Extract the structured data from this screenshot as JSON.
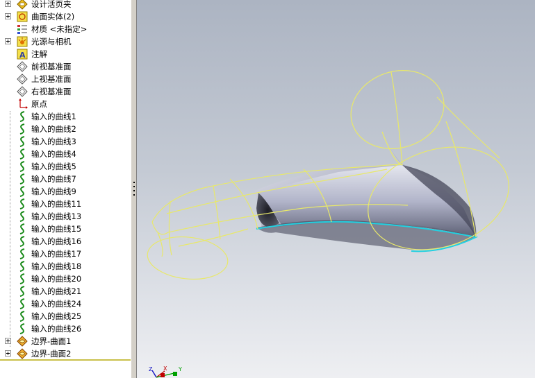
{
  "feature_tree": {
    "items": [
      {
        "label": "设计活页夹",
        "icon": "design-binder-icon",
        "expandable": true
      },
      {
        "label": "曲面实体(2)",
        "icon": "surface-bodies-icon",
        "expandable": true
      },
      {
        "label": "材质 <未指定>",
        "icon": "material-icon",
        "expandable": false
      },
      {
        "label": "光源与相机",
        "icon": "lights-cameras-icon",
        "expandable": true
      },
      {
        "label": "注解",
        "icon": "annotations-icon",
        "expandable": false
      },
      {
        "label": "前视基准面",
        "icon": "plane-icon",
        "expandable": false
      },
      {
        "label": "上视基准面",
        "icon": "plane-icon",
        "expandable": false
      },
      {
        "label": "右视基准面",
        "icon": "plane-icon",
        "expandable": false
      },
      {
        "label": "原点",
        "icon": "origin-icon",
        "expandable": false
      },
      {
        "label": "输入的曲线1",
        "icon": "curve-icon",
        "expandable": false
      },
      {
        "label": "输入的曲线2",
        "icon": "curve-icon",
        "expandable": false
      },
      {
        "label": "输入的曲线3",
        "icon": "curve-icon",
        "expandable": false
      },
      {
        "label": "输入的曲线4",
        "icon": "curve-icon",
        "expandable": false
      },
      {
        "label": "输入的曲线5",
        "icon": "curve-icon",
        "expandable": false
      },
      {
        "label": "输入的曲线7",
        "icon": "curve-icon",
        "expandable": false
      },
      {
        "label": "输入的曲线9",
        "icon": "curve-icon",
        "expandable": false
      },
      {
        "label": "输入的曲线11",
        "icon": "curve-icon",
        "expandable": false
      },
      {
        "label": "输入的曲线13",
        "icon": "curve-icon",
        "expandable": false
      },
      {
        "label": "输入的曲线15",
        "icon": "curve-icon",
        "expandable": false
      },
      {
        "label": "输入的曲线16",
        "icon": "curve-icon",
        "expandable": false
      },
      {
        "label": "输入的曲线17",
        "icon": "curve-icon",
        "expandable": false
      },
      {
        "label": "输入的曲线18",
        "icon": "curve-icon",
        "expandable": false
      },
      {
        "label": "输入的曲线20",
        "icon": "curve-icon",
        "expandable": false
      },
      {
        "label": "输入的曲线21",
        "icon": "curve-icon",
        "expandable": false
      },
      {
        "label": "输入的曲线24",
        "icon": "curve-icon",
        "expandable": false
      },
      {
        "label": "输入的曲线25",
        "icon": "curve-icon",
        "expandable": false
      },
      {
        "label": "输入的曲线26",
        "icon": "curve-icon",
        "expandable": false
      },
      {
        "label": "边界-曲面1",
        "icon": "boundary-surface-icon",
        "expandable": true
      },
      {
        "label": "边界-曲面2",
        "icon": "boundary-surface-icon",
        "expandable": true
      }
    ]
  },
  "triad": {
    "x_label": "X",
    "y_label": "Y",
    "z_label": "Z"
  },
  "colors": {
    "curve": "#e8e86a",
    "edge_highlight": "#22d0e0",
    "surface": "#b4b8d0"
  }
}
